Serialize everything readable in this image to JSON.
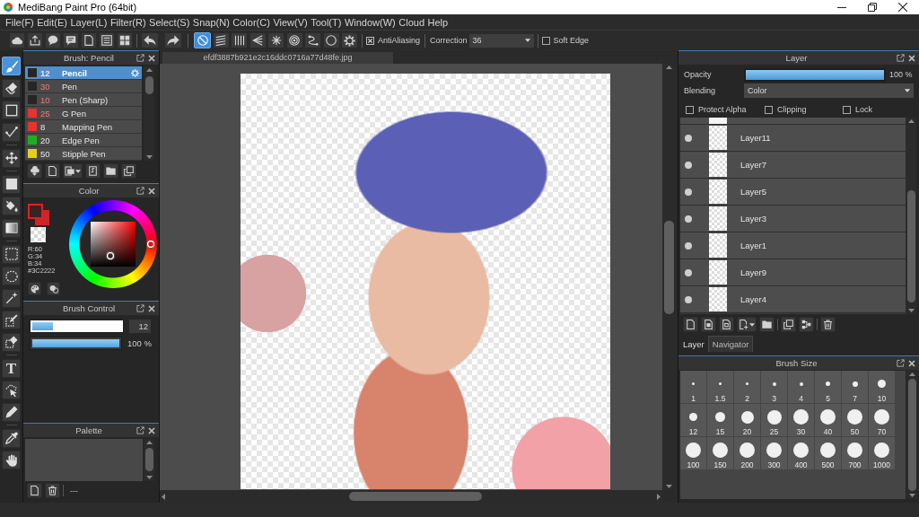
{
  "window": {
    "title": "MediBang Paint Pro (64bit)"
  },
  "menu": [
    "File(F)",
    "Edit(E)",
    "Layer(L)",
    "Filter(R)",
    "Select(S)",
    "Snap(N)",
    "Color(C)",
    "View(V)",
    "Tool(T)",
    "Window(W)",
    "Cloud",
    "Help"
  ],
  "toolbar": {
    "snap_modes": [
      {
        "selected": true
      },
      {
        "selected": false
      },
      {
        "selected": false
      },
      {
        "selected": false
      },
      {
        "selected": false
      },
      {
        "selected": false
      },
      {
        "selected": false
      },
      {
        "selected": false
      }
    ],
    "antialiasing": {
      "label": "AntiAliasing",
      "checked": true
    },
    "correction": {
      "label": "Correction",
      "value": "36"
    },
    "soft_edge": {
      "label": "Soft Edge",
      "checked": false
    }
  },
  "tools": [
    {
      "selected": true
    },
    {
      "selected": false
    },
    {
      "selected": false
    },
    {
      "selected": false
    },
    {
      "selected": false
    },
    {
      "selected": false
    },
    {
      "selected": false
    },
    {
      "selected": false
    },
    {
      "selected": false
    },
    {
      "selected": false
    },
    {
      "selected": false
    },
    {
      "selected": false
    },
    {
      "selected": false
    },
    {
      "selected": false,
      "glyph": "T"
    },
    {
      "selected": false
    },
    {
      "selected": false
    },
    {
      "selected": false
    },
    {
      "selected": false
    }
  ],
  "brush_panel": {
    "title": "Brush: Pencil",
    "brushes": [
      {
        "size": "12",
        "name": "Pencil",
        "color": "#262626",
        "size_highlighted": true,
        "selected": true
      },
      {
        "size": "30",
        "name": "Pen",
        "color": "#262626",
        "size_highlighted": true,
        "selected": false
      },
      {
        "size": "10",
        "name": "Pen (Sharp)",
        "color": "#262626",
        "size_highlighted": true,
        "selected": false
      },
      {
        "size": "25",
        "name": "G Pen",
        "color": "#e83232",
        "size_highlighted": true,
        "selected": false
      },
      {
        "size": "8",
        "name": "Mapping Pen",
        "color": "#e83232",
        "size_highlighted": false,
        "selected": false
      },
      {
        "size": "20",
        "name": "Edge Pen",
        "color": "#1fae1f",
        "size_highlighted": false,
        "selected": false
      },
      {
        "size": "50",
        "name": "Stipple Pen",
        "color": "#e6cf1c",
        "size_highlighted": false,
        "selected": false
      }
    ]
  },
  "color_panel": {
    "title": "Color",
    "foreground": {
      "color": "#3c2222"
    },
    "background": {
      "color": "#cc2626"
    },
    "readout": [
      "R:60",
      "G:34",
      "B:34",
      "#3C2222"
    ]
  },
  "brush_control": {
    "title": "Brush Control",
    "sliders": [
      {
        "level": 0.23,
        "reading": "12"
      },
      {
        "level": 1,
        "reading": "100 %"
      }
    ]
  },
  "palette": {
    "title": "Palette",
    "status": "---"
  },
  "document": {
    "tab": "efdf3887b921e2c16ddc0716a77d48fe.jpg"
  },
  "layer_panel": {
    "title": "Layer",
    "opacity": {
      "label": "Opacity",
      "level": 1,
      "reading": "100 %"
    },
    "blending": {
      "label": "Blending",
      "value": "Color"
    },
    "options": [
      {
        "label": "Protect Alpha",
        "checked": false
      },
      {
        "label": "Clipping",
        "checked": false
      },
      {
        "label": "Lock",
        "checked": false
      }
    ],
    "top_row_cut": true,
    "layers": [
      {
        "name": "Layer11",
        "visible": true,
        "selected": false
      },
      {
        "name": "Layer7",
        "visible": true,
        "selected": false
      },
      {
        "name": "Layer5",
        "visible": true,
        "selected": false
      },
      {
        "name": "Layer3",
        "visible": true,
        "selected": false
      },
      {
        "name": "Layer1",
        "visible": true,
        "selected": false
      },
      {
        "name": "Layer9",
        "visible": true,
        "selected": false
      },
      {
        "name": "Layer4",
        "visible": true,
        "selected": false
      }
    ]
  },
  "panel_tabs": [
    {
      "label": "Layer",
      "selected": true
    },
    {
      "label": "Navigator",
      "selected": false
    }
  ],
  "brush_size": {
    "title": "Brush Size",
    "sizes": [
      "1",
      "1.5",
      "2",
      "3",
      "4",
      "5",
      "7",
      "10",
      "12",
      "15",
      "20",
      "25",
      "30",
      "40",
      "50",
      "70",
      "100",
      "150",
      "200",
      "300",
      "400",
      "500",
      "700",
      "1000"
    ]
  }
}
